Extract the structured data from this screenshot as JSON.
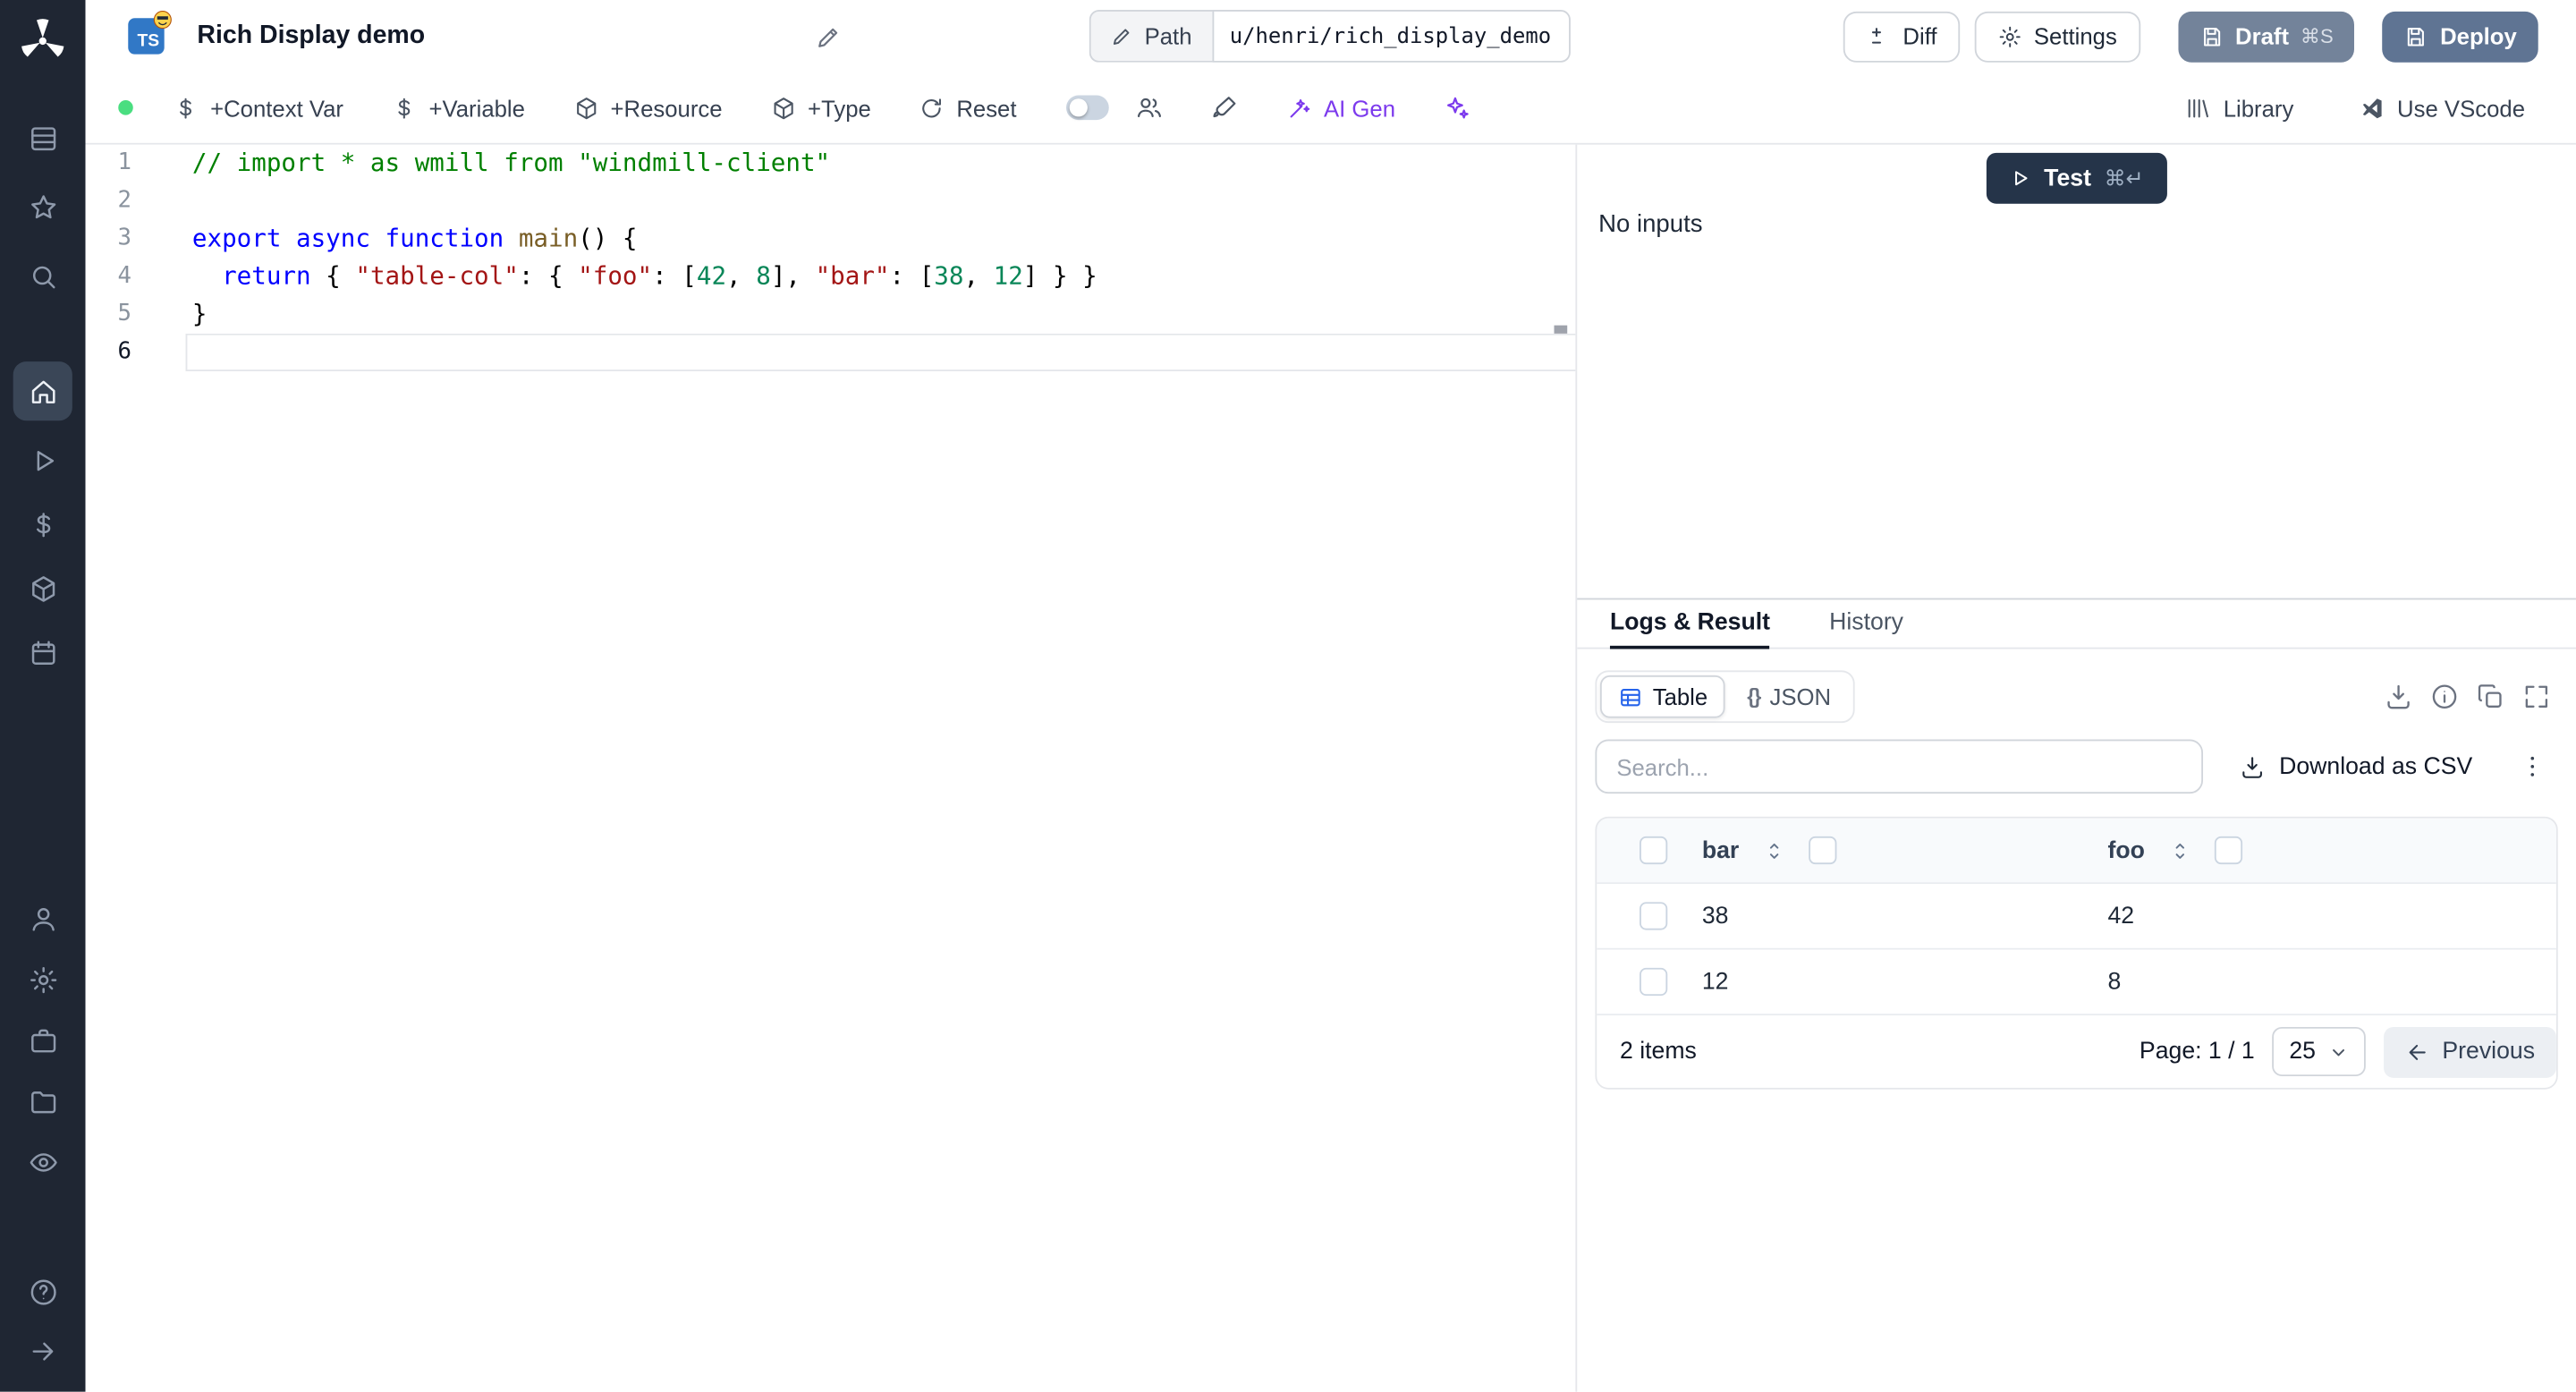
{
  "colors": {
    "sidebar_bg": "#1f2633",
    "accent_ts": "#3178c6",
    "btn_draft": "#73839a",
    "btn_deploy": "#5f7493",
    "ai_violet": "#7c3aed",
    "test_btn": "#253449",
    "status_green": "#4ade80",
    "table_icon_blue": "#2563eb"
  },
  "header": {
    "language_badge": "TS",
    "title": "Rich Display demo",
    "path_label": "Path",
    "path_value": "u/henri/rich_display_demo",
    "diff_label": "Diff",
    "settings_label": "Settings",
    "draft_label": "Draft",
    "draft_shortcut": "⌘S",
    "deploy_label": "Deploy"
  },
  "toolbar": {
    "context_var": "+Context Var",
    "variable": "+Variable",
    "resource": "+Resource",
    "type": "+Type",
    "reset": "Reset",
    "ai_gen": "AI Gen",
    "library": "Library",
    "vscode": "Use VScode"
  },
  "editor": {
    "lines": [
      {
        "n": "1",
        "tokens": [
          {
            "c": "comment",
            "t": "// import * as wmill from \"windmill-client\""
          }
        ]
      },
      {
        "n": "2",
        "tokens": []
      },
      {
        "n": "3",
        "tokens": [
          {
            "c": "kw",
            "t": "export"
          },
          {
            "c": "pln",
            "t": " "
          },
          {
            "c": "kw",
            "t": "async"
          },
          {
            "c": "pln",
            "t": " "
          },
          {
            "c": "kw",
            "t": "function"
          },
          {
            "c": "pln",
            "t": " "
          },
          {
            "c": "fn",
            "t": "main"
          },
          {
            "c": "pln",
            "t": "() {"
          }
        ]
      },
      {
        "n": "4",
        "tokens": [
          {
            "c": "pln",
            "t": "  "
          },
          {
            "c": "kw",
            "t": "return"
          },
          {
            "c": "pln",
            "t": " { "
          },
          {
            "c": "str",
            "t": "\"table-col\""
          },
          {
            "c": "pln",
            "t": ": { "
          },
          {
            "c": "str",
            "t": "\"foo\""
          },
          {
            "c": "pln",
            "t": ": ["
          },
          {
            "c": "num",
            "t": "42"
          },
          {
            "c": "pln",
            "t": ", "
          },
          {
            "c": "num",
            "t": "8"
          },
          {
            "c": "pln",
            "t": "], "
          },
          {
            "c": "str",
            "t": "\"bar\""
          },
          {
            "c": "pln",
            "t": ": ["
          },
          {
            "c": "num",
            "t": "38"
          },
          {
            "c": "pln",
            "t": ", "
          },
          {
            "c": "num",
            "t": "12"
          },
          {
            "c": "pln",
            "t": "] } }"
          }
        ]
      },
      {
        "n": "5",
        "tokens": [
          {
            "c": "pln",
            "t": "}"
          }
        ]
      },
      {
        "n": "6",
        "tokens": [],
        "current": true
      }
    ]
  },
  "run": {
    "test_label": "Test",
    "test_shortcut": "⌘↵",
    "no_inputs": "No inputs"
  },
  "result": {
    "tabs": [
      {
        "label": "Logs & Result",
        "active": true
      },
      {
        "label": "History",
        "active": false
      }
    ],
    "view_toggle": {
      "table": "Table",
      "json": "JSON",
      "json_braces": "{}"
    },
    "search_placeholder": "Search...",
    "download_csv": "Download as CSV",
    "table": {
      "columns": [
        "bar",
        "foo"
      ],
      "rows": [
        [
          "38",
          "42"
        ],
        [
          "12",
          "8"
        ]
      ]
    },
    "footer": {
      "items": "2 items",
      "page": "Page: 1 / 1",
      "page_size": "25",
      "previous": "Previous"
    }
  }
}
